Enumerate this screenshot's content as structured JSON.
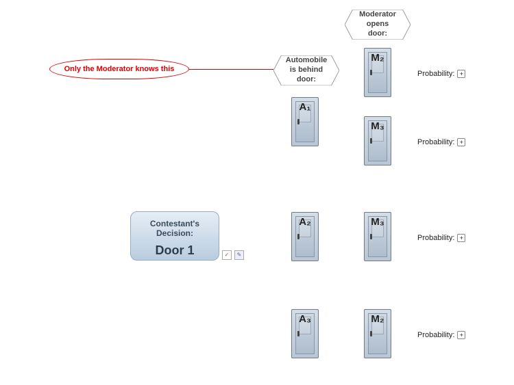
{
  "headers": {
    "automobile": "Automobile\nis behind\ndoor:",
    "moderator": "Moderator\nopens\ndoor:"
  },
  "note": "Only the Moderator knows this",
  "decision": {
    "title": "Contestant's\nDecision:",
    "choice": "Door 1"
  },
  "doors": {
    "a1": "A₁",
    "a2": "A₂",
    "a3": "A₃",
    "m2_top": "M₂",
    "m3_a": "M₃",
    "m3_b": "M₃",
    "m2_bot": "M₂"
  },
  "prob_label": "Probability:",
  "expander": "+"
}
